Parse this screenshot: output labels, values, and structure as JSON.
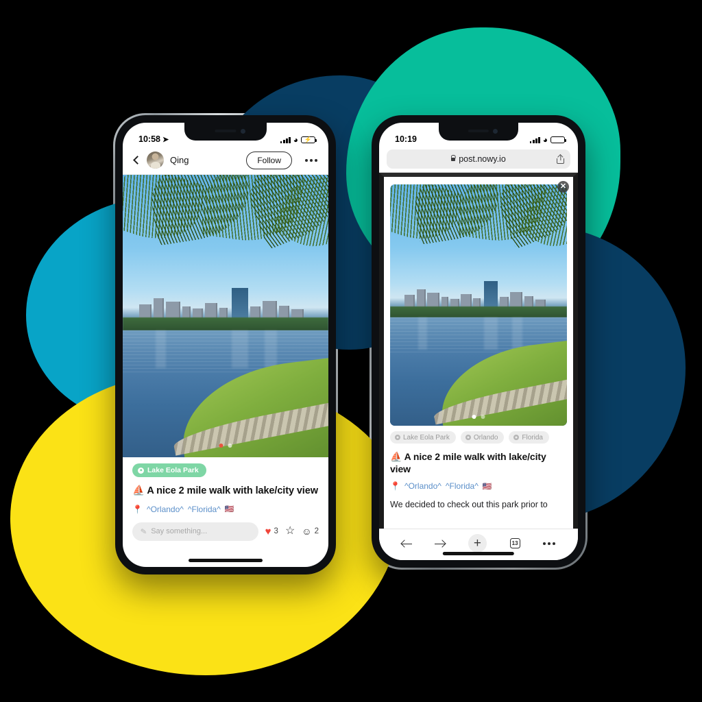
{
  "palette": {
    "teal": "#08A4C7",
    "navy": "#083D62",
    "green": "#07BE9B",
    "yellow": "#FBE216",
    "badge_green": "#7ED6A5",
    "heart_red": "#F0453A",
    "link_blue": "#5B8FC9"
  },
  "left_phone": {
    "status": {
      "time": "10:58",
      "location_arrow_icon": "location-arrow-icon",
      "signal_icon": "cellular-bars-icon",
      "wifi_icon": "wifi-icon",
      "battery_icon": "battery-charging-icon"
    },
    "header": {
      "back_icon": "chevron-left-icon",
      "avatar_name": "avatar",
      "username": "Qing",
      "follow_label": "Follow",
      "more_icon": "more-horizontal-icon"
    },
    "photo": {
      "alt": "Lake Eola Park skyline seen through palm fronds",
      "carousel_dots": 2,
      "active_dot": 1
    },
    "post": {
      "location_badge": "Lake Eola Park",
      "location_pin_icon": "map-pin-icon",
      "title": "⛵ A nice 2 mile walk with lake/city view",
      "tag_pin_icon": "pin-emoji-icon",
      "tags": [
        "^Orlando^",
        "^Florida^"
      ],
      "flag": "🇺🇸"
    },
    "actions": {
      "comment_placeholder": "Say something...",
      "pencil_icon": "pencil-icon",
      "like_icon": "heart-icon",
      "like_count": "3",
      "bookmark_icon": "star-icon",
      "comment_icon": "comment-bubble-icon",
      "comment_count": "2"
    }
  },
  "right_phone": {
    "status": {
      "time": "10:19",
      "signal_icon": "cellular-bars-icon",
      "wifi_icon": "wifi-icon",
      "battery_icon": "battery-icon"
    },
    "browser": {
      "lock_icon": "lock-icon",
      "url": "post.nowy.io",
      "share_icon": "share-icon"
    },
    "page": {
      "close_icon": "close-circle-icon",
      "close_label": "✕",
      "carousel_dots": 2,
      "active_dot": 1,
      "tags": [
        "Lake Eola Park",
        "Orlando",
        "Florida"
      ],
      "tag_pin_icon": "map-pin-icon",
      "title": "⛵ A nice 2 mile walk with lake/city view",
      "sub_pin_icon": "pin-emoji-icon",
      "sub_tags": [
        "^Orlando^",
        "^Florida^"
      ],
      "flag": "🇺🇸",
      "paragraph": "We decided to check out this park prior to"
    },
    "toolbar": {
      "back_icon": "arrow-left-icon",
      "forward_icon": "arrow-right-icon",
      "add_icon": "plus-icon",
      "add_label": "+",
      "tabs_icon": "tabs-icon",
      "tabs_count": "13",
      "more_icon": "more-horizontal-icon"
    }
  }
}
